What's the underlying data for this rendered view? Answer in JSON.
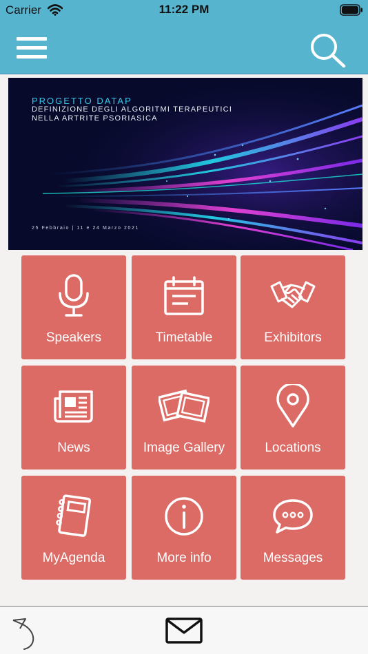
{
  "status_bar": {
    "carrier": "Carrier",
    "time": "11:22 PM",
    "wifi_icon": "wifi-icon",
    "battery_icon": "battery-icon"
  },
  "nav": {
    "menu_icon": "hamburger-menu-icon",
    "search_icon": "search-icon",
    "background_color": "#57b4cf"
  },
  "banner": {
    "title": "PROGETTO DATAP",
    "subtitle": "DEFINIZIONE DEGLI ALGORITMI TERAPEUTICI NELLA ARTRITE PSORIASICA",
    "dates": "25 Febbraio | 11 e 24 Marzo 2021"
  },
  "tiles": [
    {
      "label": "Speakers",
      "icon": "microphone-icon"
    },
    {
      "label": "Timetable",
      "icon": "calendar-icon"
    },
    {
      "label": "Exhibitors",
      "icon": "handshake-icon"
    },
    {
      "label": "News",
      "icon": "newspaper-icon"
    },
    {
      "label": "Image Gallery",
      "icon": "photos-icon"
    },
    {
      "label": "Locations",
      "icon": "location-pin-icon"
    },
    {
      "label": "MyAgenda",
      "icon": "notebook-icon"
    },
    {
      "label": "More info",
      "icon": "info-icon"
    },
    {
      "label": "Messages",
      "icon": "chat-bubble-icon"
    }
  ],
  "tile_color": "#dc6b66",
  "bottom_bar": {
    "back_icon": "back-arrow-icon",
    "mail_icon": "mail-icon"
  }
}
